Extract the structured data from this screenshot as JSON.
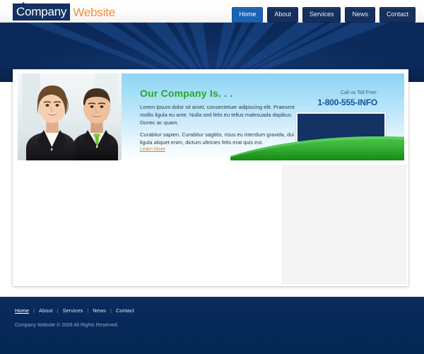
{
  "site": {
    "logo_word1": "Company",
    "logo_word2": "Website",
    "logo_mark": "swoosh-icon"
  },
  "topnav": {
    "items": [
      {
        "label": "Home",
        "active": true
      },
      {
        "label": "About",
        "active": false
      },
      {
        "label": "Services",
        "active": false
      },
      {
        "label": "News",
        "active": false
      },
      {
        "label": "Contact",
        "active": false
      }
    ]
  },
  "feature": {
    "photo_alt": "two-business-people-photo",
    "headline": "Our Company Is. . .",
    "paragraph1": "Lorem ipsum dolor sit amet, consectetuer adipiscing elit. Praesent mollis ligula eu ante. Nulla sed felis eu tellus malesuada dapibus. Donec ac quam.",
    "paragraph2": "Curabitur sapien. Curabitur sagittis, risus eu interdum gravida, dui ligula aliquet enim, dictum ultricies felis erat quis est.",
    "learn_more": "Learn More",
    "call_label": "Call us Toll Free:",
    "phone": "1-800-555-INFO",
    "promo_box": ""
  },
  "footer": {
    "links": [
      {
        "label": "Home",
        "current": true
      },
      {
        "label": "About",
        "current": false
      },
      {
        "label": "Services",
        "current": false
      },
      {
        "label": "News",
        "current": false
      },
      {
        "label": "Contact",
        "current": false
      }
    ],
    "separator": "|",
    "copyright": "Company Website © 2009 All Rights Reserved."
  },
  "colors": {
    "navy": "#0b2a5b",
    "navy_dark": "#143263",
    "accent_orange": "#e8913c",
    "accent_green": "#2aa52a",
    "link_blue": "#1a62b4",
    "phone_blue": "#15539c",
    "panel_blue": "#a9e0f8",
    "hill_green": "#3fb63f"
  }
}
